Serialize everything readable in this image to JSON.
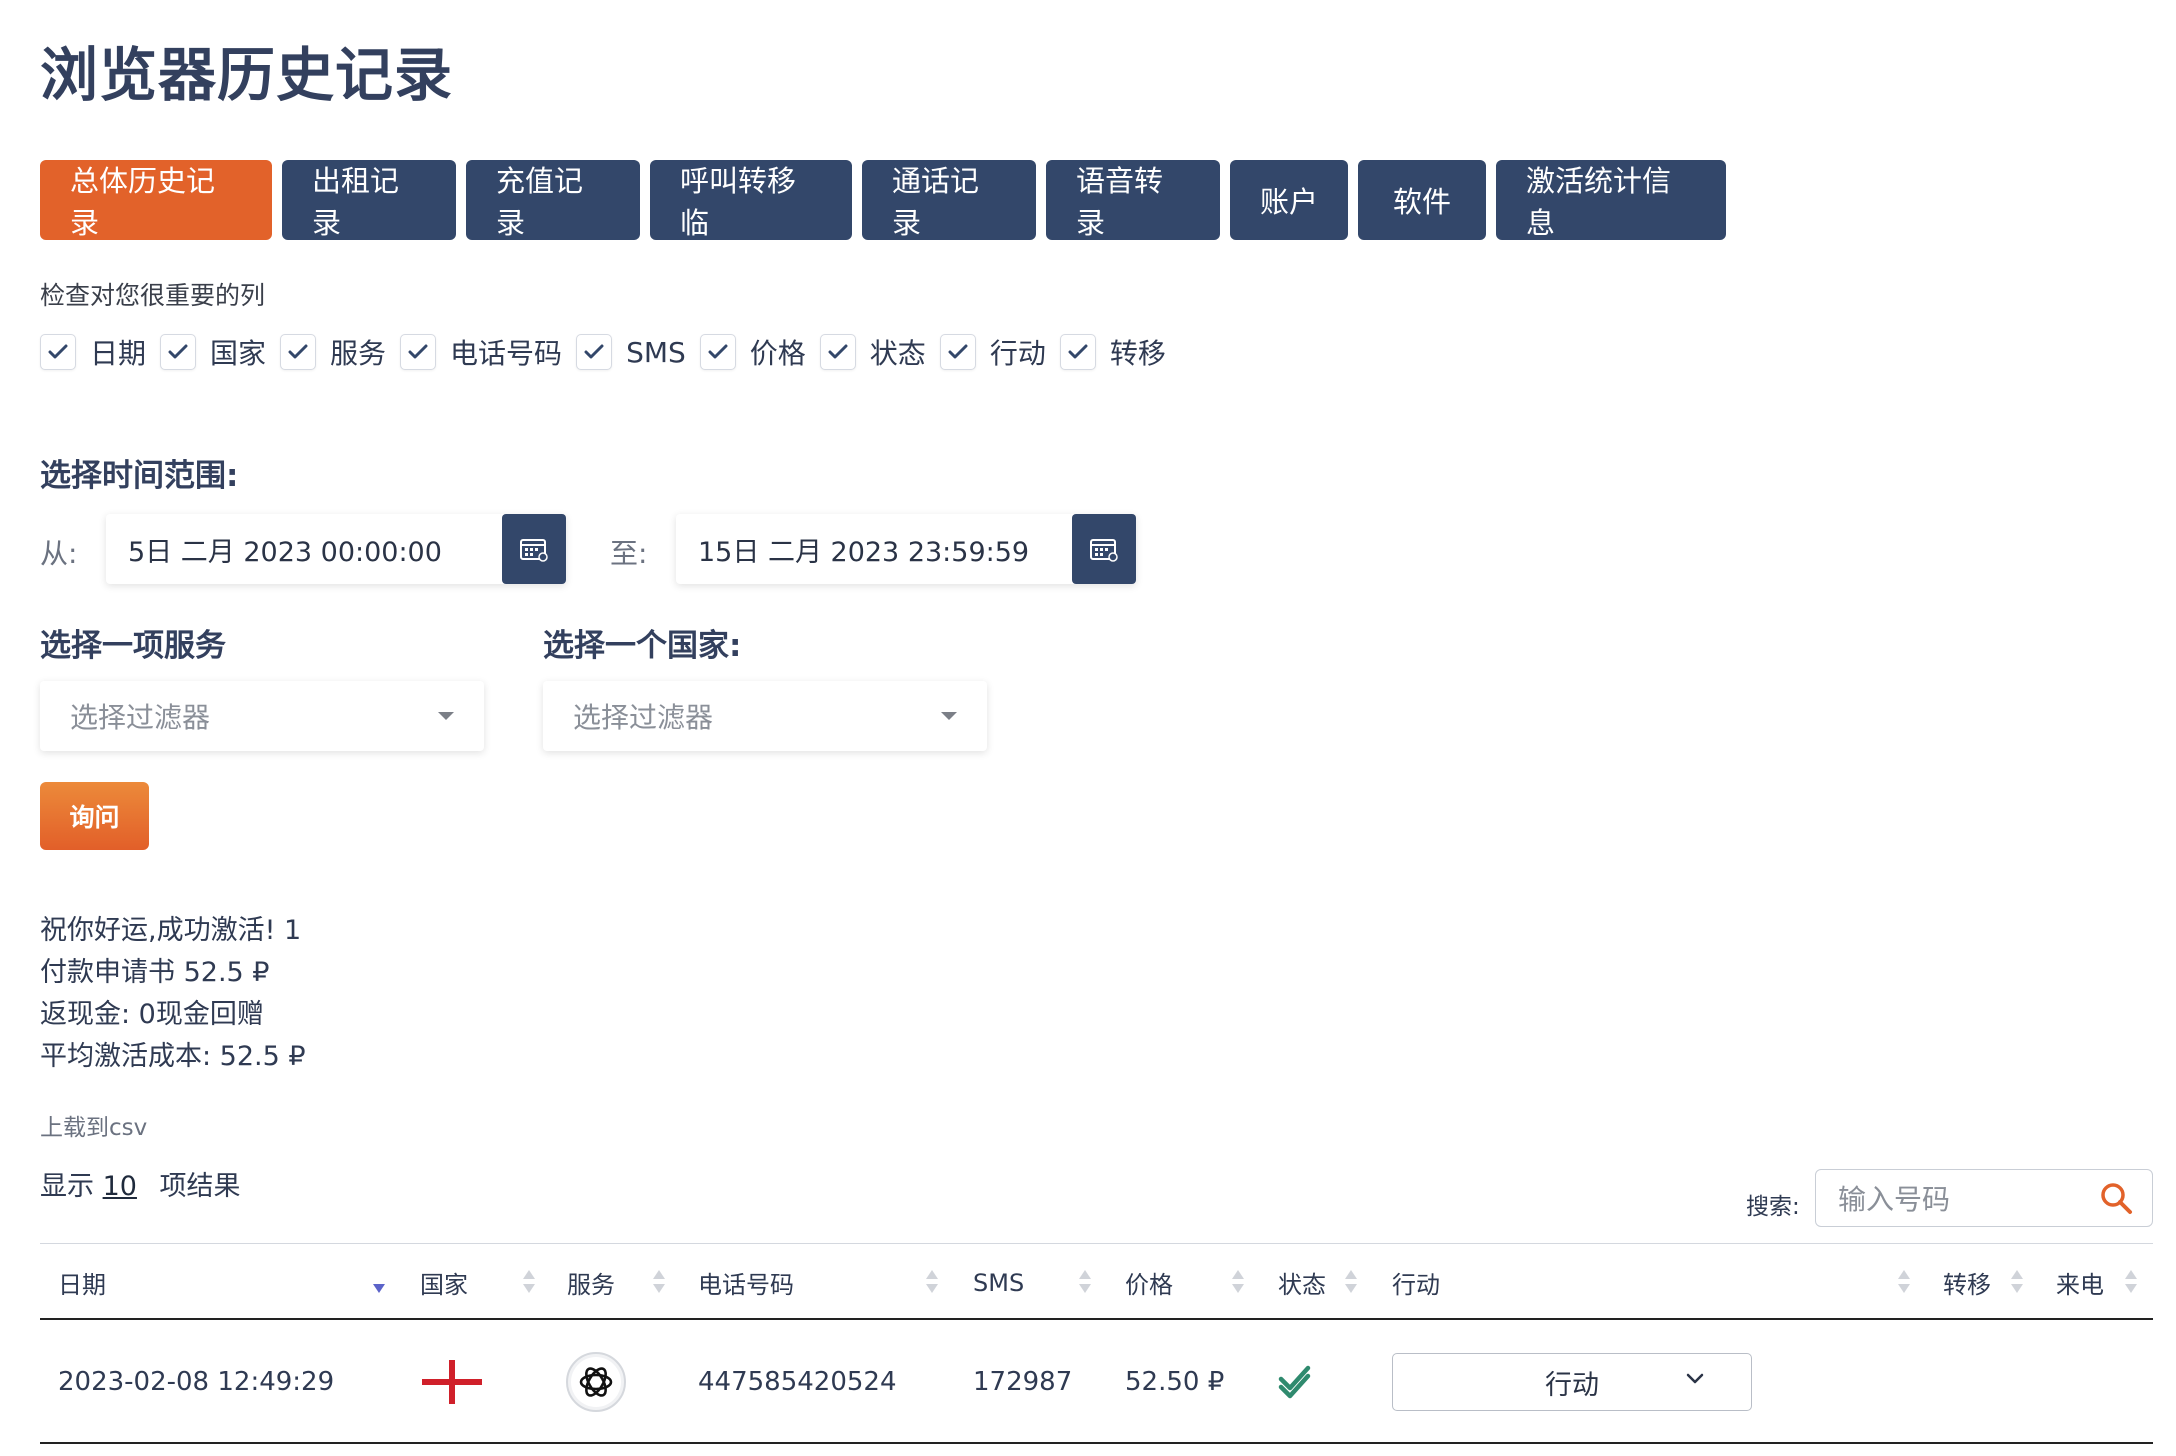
{
  "page": {
    "title": "浏览器历史记录"
  },
  "tabs": [
    "总体历史记录",
    "出租记录",
    "充值记录",
    "呼叫转移临",
    "通话记录",
    "语音转录",
    "账户",
    "软件",
    "激活统计信息"
  ],
  "columns_note": "检查对您很重要的列",
  "column_checks": [
    "日期",
    "国家",
    "服务",
    "电话号码",
    "SMS",
    "价格",
    "状态",
    "行动",
    "转移"
  ],
  "time_range": {
    "title": "选择时间范围:",
    "from_label": "从:",
    "from_value": "5日 二月 2023 00:00:00",
    "to_label": "至:",
    "to_value": "15日 二月 2023 23:59:59"
  },
  "filters": {
    "service_title": "选择一项服务",
    "service_placeholder": "选择过滤器",
    "country_title": "选择一个国家:",
    "country_placeholder": "选择过滤器"
  },
  "query_button": "询问",
  "summary": {
    "line1": "祝你好运,成功激活! 1",
    "line2": "付款申请书 52.5 ₽",
    "line3": "返现金: 0现金回赠",
    "line4": "平均激活成本: 52.5 ₽"
  },
  "csv_link": "上载到csv",
  "pagination": {
    "show": "显示",
    "count": "10",
    "suffix": "项结果"
  },
  "search": {
    "label": "搜索:",
    "placeholder": "输入号码"
  },
  "table": {
    "headers": [
      "日期",
      "国家",
      "服务",
      "电话号码",
      "SMS",
      "价格",
      "状态",
      "行动",
      "转移",
      "来电"
    ],
    "rows": [
      {
        "date": "2023-02-08 12:49:29",
        "country_icon": "red-cross-flag-icon",
        "service_icon": "openai-icon",
        "phone": "447585420524",
        "sms": "172987",
        "price": "52.50 ₽",
        "status_icon": "double-check-icon",
        "action": "行动"
      }
    ]
  },
  "colors": {
    "primary": "#33476a",
    "accent": "#e2622a",
    "title": "#33405e",
    "status_ok": "#2f8a6e",
    "flag_red": "#d0202a"
  }
}
